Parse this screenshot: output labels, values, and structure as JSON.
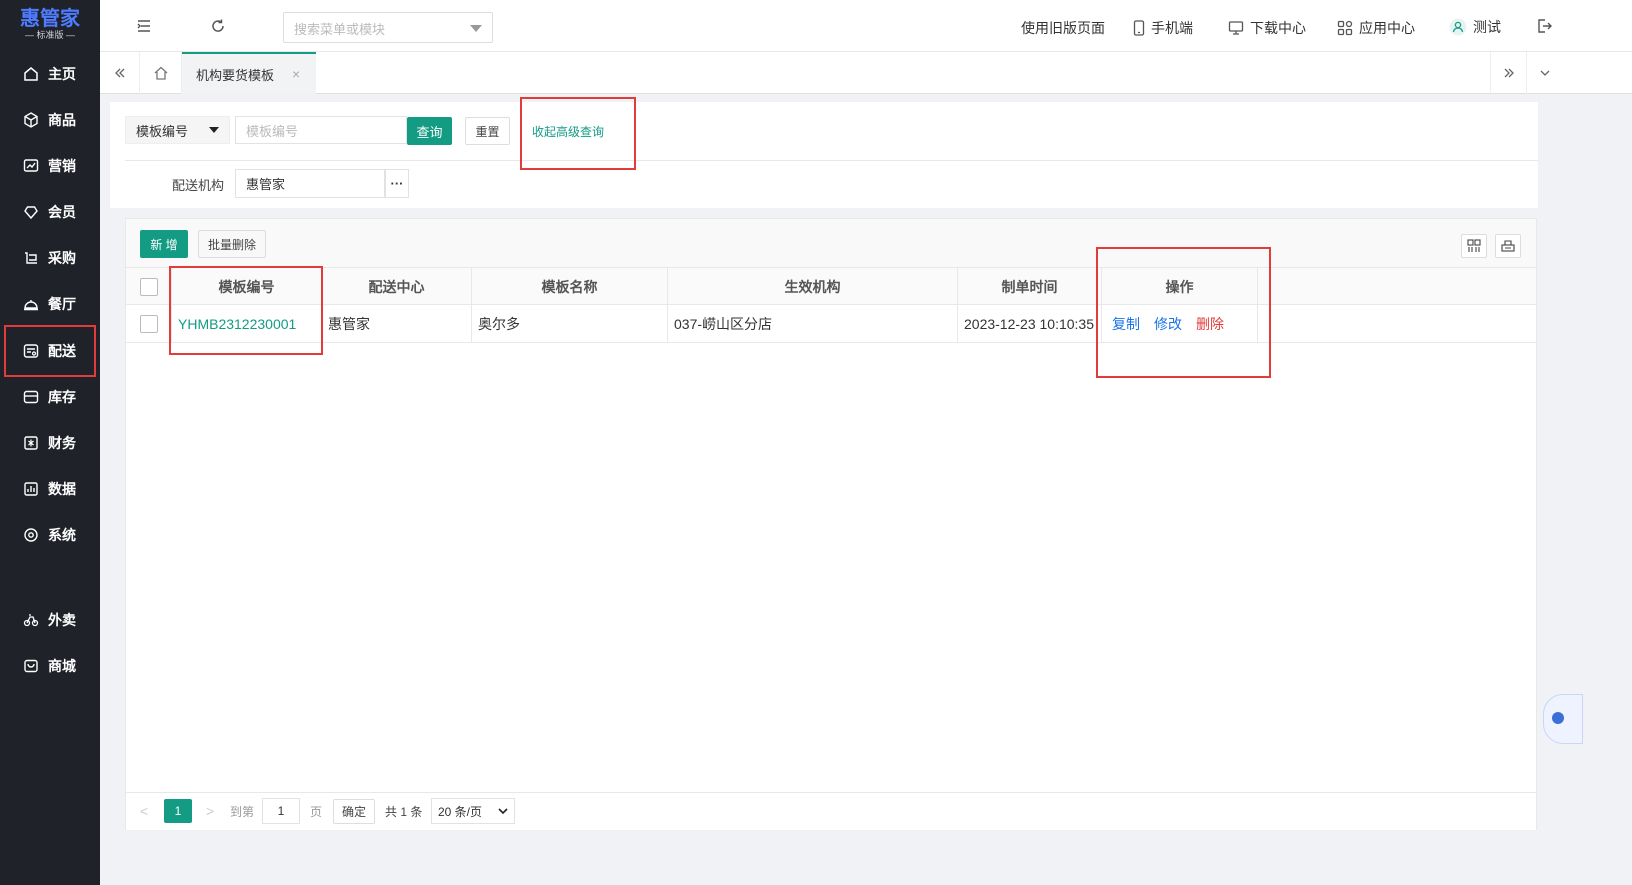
{
  "brand": {
    "name": "惠管家",
    "edition": "— 标准版 —"
  },
  "sidebar": {
    "items": [
      {
        "label": "主页",
        "icon": "home-icon"
      },
      {
        "label": "商品",
        "icon": "cube-icon"
      },
      {
        "label": "营销",
        "icon": "chart-icon"
      },
      {
        "label": "会员",
        "icon": "diamond-icon"
      },
      {
        "label": "采购",
        "icon": "cart-icon"
      },
      {
        "label": "餐厅",
        "icon": "dish-icon"
      },
      {
        "label": "配送",
        "icon": "truck-icon"
      },
      {
        "label": "库存",
        "icon": "box-icon"
      },
      {
        "label": "财务",
        "icon": "finance-icon"
      },
      {
        "label": "数据",
        "icon": "data-icon"
      },
      {
        "label": "系统",
        "icon": "settings-icon"
      },
      {
        "label": "外卖",
        "icon": "bike-icon"
      },
      {
        "label": "商城",
        "icon": "store-icon"
      }
    ],
    "active": "配送"
  },
  "header": {
    "search_placeholder": "搜索菜单或模块",
    "old_version": "使用旧版页面",
    "mobile": "手机端",
    "download": "下载中心",
    "apps": "应用中心",
    "user": "测试"
  },
  "tabs": {
    "current": "机构要货模板",
    "close": "×"
  },
  "filters": {
    "field_select": "模板编号",
    "field_placeholder": "模板编号",
    "query": "查询",
    "reset": "重置",
    "collapse": "收起高级查询",
    "org_label": "配送机构",
    "org_value": "惠管家",
    "org_more": "···"
  },
  "toolbar": {
    "add": "新 增",
    "batch_delete": "批量删除"
  },
  "table": {
    "columns": [
      "模板编号",
      "配送中心",
      "模板名称",
      "生效机构",
      "制单时间",
      "操作"
    ],
    "rows": [
      {
        "code": "YHMB2312230001",
        "center": "惠管家",
        "name": "奥尔多",
        "org": "037-崂山区分店",
        "time": "2023-12-23 10:10:35"
      }
    ],
    "actions": {
      "copy": "复制",
      "edit": "修改",
      "delete": "删除"
    }
  },
  "pagination": {
    "current_page": "1",
    "goto_label": "到第",
    "goto_value": "1",
    "page_unit": "页",
    "confirm": "确定",
    "total": "共 1 条",
    "page_size": "20 条/页"
  },
  "colors": {
    "accent": "#139b84",
    "link_blue": "#1a73e8",
    "danger": "#e23b3b",
    "sidebar_bg": "#1f2229"
  }
}
